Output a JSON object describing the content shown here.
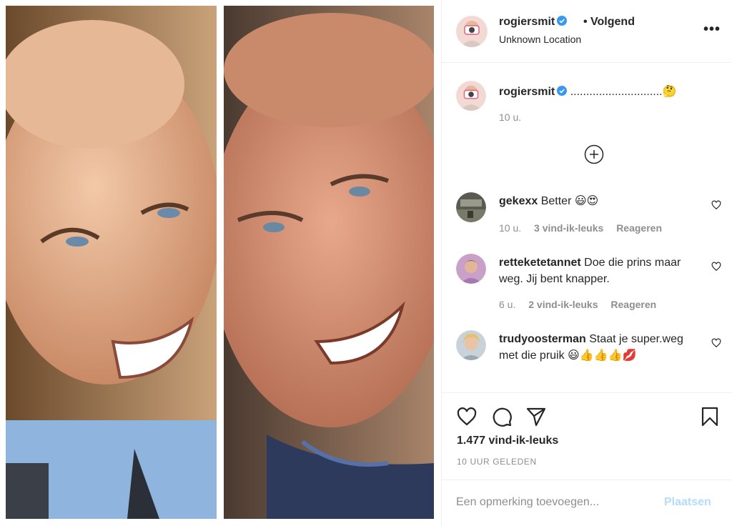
{
  "post": {
    "username": "rogiersmit",
    "follow_status": "• Volgend",
    "location": "Unknown Location",
    "more_label": "•••"
  },
  "caption": {
    "username": "rogiersmit",
    "text": ".............................🤔",
    "time": "10 u."
  },
  "comments": [
    {
      "username": "gekexx",
      "text": "Better 😃😍",
      "time": "10 u.",
      "likes": "3 vind-ik-leuks",
      "reply": "Reageren"
    },
    {
      "username": "retteketetannet",
      "text": "Doe die prins maar weg. Jij bent knapper.",
      "time": "6 u.",
      "likes": "2 vind-ik-leuks",
      "reply": "Reageren"
    },
    {
      "username": "trudyoosterman",
      "text": "Staat je super.weg met die pruik 😃👍👍👍💋",
      "time": "",
      "likes": "",
      "reply": ""
    }
  ],
  "actions": {
    "like_icon": "heart-outline",
    "comment_icon": "speech-bubble",
    "share_icon": "paper-plane",
    "save_icon": "bookmark"
  },
  "likes_count": "1.477 vind-ik-leuks",
  "posted_ago": "10 UUR GELEDEN",
  "add_comment": {
    "placeholder": "Een opmerking toevoegen...",
    "post_label": "Plaatsen"
  },
  "colors": {
    "verified": "#3897f0",
    "border": "#efefef",
    "secondary_text": "#8e8e8e",
    "post_button_disabled": "#b3dbff"
  }
}
